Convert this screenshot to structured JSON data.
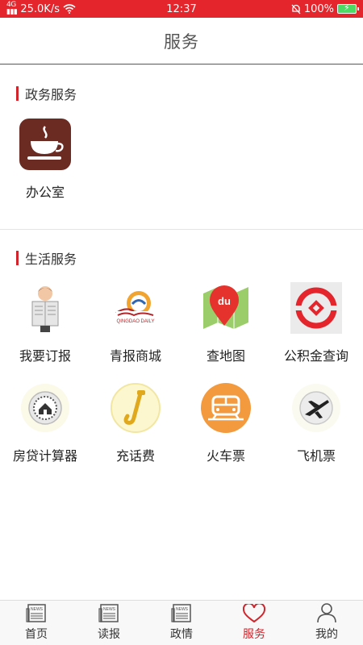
{
  "status_bar": {
    "network": "4G",
    "speed": "25.0K/s",
    "time": "12:37",
    "battery": "100%"
  },
  "header": {
    "title": "服务"
  },
  "sections": [
    {
      "title": "政务服务",
      "items": [
        {
          "label": "办公室",
          "icon": "coffee-cup-icon"
        }
      ]
    },
    {
      "title": "生活服务",
      "items": [
        {
          "label": "我要订报",
          "icon": "newspaper-reader-icon"
        },
        {
          "label": "青报商城",
          "icon": "qingdao-daily-logo-icon"
        },
        {
          "label": "查地图",
          "icon": "baidu-map-icon"
        },
        {
          "label": "公积金查询",
          "icon": "housing-fund-icon"
        },
        {
          "label": "房贷计算器",
          "icon": "mortgage-calculator-icon"
        },
        {
          "label": "充话费",
          "icon": "phone-recharge-icon"
        },
        {
          "label": "火车票",
          "icon": "train-icon"
        },
        {
          "label": "飞机票",
          "icon": "airplane-icon"
        }
      ]
    }
  ],
  "logo_text": {
    "qingdao_daily_en": "QINGDAO DAILY"
  },
  "tabs": [
    {
      "label": "首页",
      "icon": "newspaper-icon",
      "active": false
    },
    {
      "label": "读报",
      "icon": "newspaper-icon",
      "active": false
    },
    {
      "label": "政情",
      "icon": "newspaper-icon",
      "active": false
    },
    {
      "label": "服务",
      "icon": "heart-icon",
      "active": true
    },
    {
      "label": "我的",
      "icon": "user-icon",
      "active": false
    }
  ],
  "colors": {
    "accent": "#d0252c",
    "status_bar": "#e5252c"
  }
}
